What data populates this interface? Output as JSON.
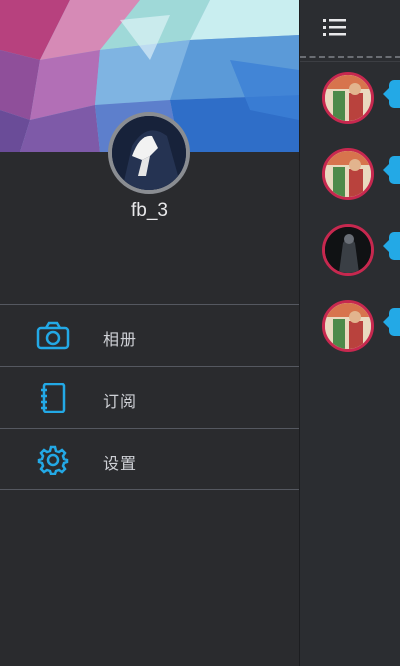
{
  "drawer": {
    "username": "fb_3",
    "menu": [
      {
        "label": "相册",
        "icon": "camera-icon"
      },
      {
        "label": "订阅",
        "icon": "notebook-icon"
      },
      {
        "label": "设置",
        "icon": "gear-icon"
      }
    ]
  },
  "main": {
    "menu_icon": "list-menu-icon",
    "feed_count_visible": 4
  },
  "colors": {
    "accent": "#23a9e6",
    "background": "#2a2b2e",
    "avatar_ring": "#c7284f"
  }
}
